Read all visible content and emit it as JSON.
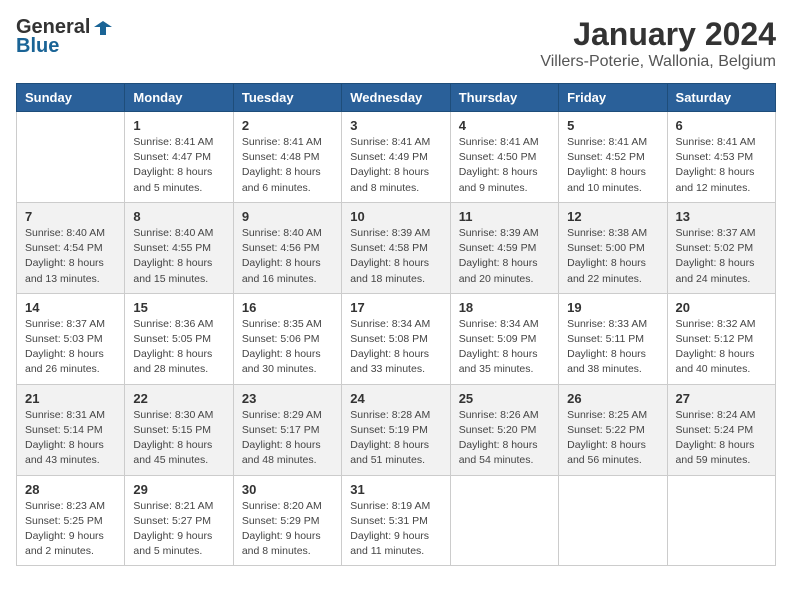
{
  "logo": {
    "general": "General",
    "blue": "Blue"
  },
  "title": "January 2024",
  "subtitle": "Villers-Poterie, Wallonia, Belgium",
  "days_of_week": [
    "Sunday",
    "Monday",
    "Tuesday",
    "Wednesday",
    "Thursday",
    "Friday",
    "Saturday"
  ],
  "weeks": [
    [
      {
        "day": "",
        "info": ""
      },
      {
        "day": "1",
        "info": "Sunrise: 8:41 AM\nSunset: 4:47 PM\nDaylight: 8 hours\nand 5 minutes."
      },
      {
        "day": "2",
        "info": "Sunrise: 8:41 AM\nSunset: 4:48 PM\nDaylight: 8 hours\nand 6 minutes."
      },
      {
        "day": "3",
        "info": "Sunrise: 8:41 AM\nSunset: 4:49 PM\nDaylight: 8 hours\nand 8 minutes."
      },
      {
        "day": "4",
        "info": "Sunrise: 8:41 AM\nSunset: 4:50 PM\nDaylight: 8 hours\nand 9 minutes."
      },
      {
        "day": "5",
        "info": "Sunrise: 8:41 AM\nSunset: 4:52 PM\nDaylight: 8 hours\nand 10 minutes."
      },
      {
        "day": "6",
        "info": "Sunrise: 8:41 AM\nSunset: 4:53 PM\nDaylight: 8 hours\nand 12 minutes."
      }
    ],
    [
      {
        "day": "7",
        "info": "Sunrise: 8:40 AM\nSunset: 4:54 PM\nDaylight: 8 hours\nand 13 minutes."
      },
      {
        "day": "8",
        "info": "Sunrise: 8:40 AM\nSunset: 4:55 PM\nDaylight: 8 hours\nand 15 minutes."
      },
      {
        "day": "9",
        "info": "Sunrise: 8:40 AM\nSunset: 4:56 PM\nDaylight: 8 hours\nand 16 minutes."
      },
      {
        "day": "10",
        "info": "Sunrise: 8:39 AM\nSunset: 4:58 PM\nDaylight: 8 hours\nand 18 minutes."
      },
      {
        "day": "11",
        "info": "Sunrise: 8:39 AM\nSunset: 4:59 PM\nDaylight: 8 hours\nand 20 minutes."
      },
      {
        "day": "12",
        "info": "Sunrise: 8:38 AM\nSunset: 5:00 PM\nDaylight: 8 hours\nand 22 minutes."
      },
      {
        "day": "13",
        "info": "Sunrise: 8:37 AM\nSunset: 5:02 PM\nDaylight: 8 hours\nand 24 minutes."
      }
    ],
    [
      {
        "day": "14",
        "info": "Sunrise: 8:37 AM\nSunset: 5:03 PM\nDaylight: 8 hours\nand 26 minutes."
      },
      {
        "day": "15",
        "info": "Sunrise: 8:36 AM\nSunset: 5:05 PM\nDaylight: 8 hours\nand 28 minutes."
      },
      {
        "day": "16",
        "info": "Sunrise: 8:35 AM\nSunset: 5:06 PM\nDaylight: 8 hours\nand 30 minutes."
      },
      {
        "day": "17",
        "info": "Sunrise: 8:34 AM\nSunset: 5:08 PM\nDaylight: 8 hours\nand 33 minutes."
      },
      {
        "day": "18",
        "info": "Sunrise: 8:34 AM\nSunset: 5:09 PM\nDaylight: 8 hours\nand 35 minutes."
      },
      {
        "day": "19",
        "info": "Sunrise: 8:33 AM\nSunset: 5:11 PM\nDaylight: 8 hours\nand 38 minutes."
      },
      {
        "day": "20",
        "info": "Sunrise: 8:32 AM\nSunset: 5:12 PM\nDaylight: 8 hours\nand 40 minutes."
      }
    ],
    [
      {
        "day": "21",
        "info": "Sunrise: 8:31 AM\nSunset: 5:14 PM\nDaylight: 8 hours\nand 43 minutes."
      },
      {
        "day": "22",
        "info": "Sunrise: 8:30 AM\nSunset: 5:15 PM\nDaylight: 8 hours\nand 45 minutes."
      },
      {
        "day": "23",
        "info": "Sunrise: 8:29 AM\nSunset: 5:17 PM\nDaylight: 8 hours\nand 48 minutes."
      },
      {
        "day": "24",
        "info": "Sunrise: 8:28 AM\nSunset: 5:19 PM\nDaylight: 8 hours\nand 51 minutes."
      },
      {
        "day": "25",
        "info": "Sunrise: 8:26 AM\nSunset: 5:20 PM\nDaylight: 8 hours\nand 54 minutes."
      },
      {
        "day": "26",
        "info": "Sunrise: 8:25 AM\nSunset: 5:22 PM\nDaylight: 8 hours\nand 56 minutes."
      },
      {
        "day": "27",
        "info": "Sunrise: 8:24 AM\nSunset: 5:24 PM\nDaylight: 8 hours\nand 59 minutes."
      }
    ],
    [
      {
        "day": "28",
        "info": "Sunrise: 8:23 AM\nSunset: 5:25 PM\nDaylight: 9 hours\nand 2 minutes."
      },
      {
        "day": "29",
        "info": "Sunrise: 8:21 AM\nSunset: 5:27 PM\nDaylight: 9 hours\nand 5 minutes."
      },
      {
        "day": "30",
        "info": "Sunrise: 8:20 AM\nSunset: 5:29 PM\nDaylight: 9 hours\nand 8 minutes."
      },
      {
        "day": "31",
        "info": "Sunrise: 8:19 AM\nSunset: 5:31 PM\nDaylight: 9 hours\nand 11 minutes."
      },
      {
        "day": "",
        "info": ""
      },
      {
        "day": "",
        "info": ""
      },
      {
        "day": "",
        "info": ""
      }
    ]
  ]
}
